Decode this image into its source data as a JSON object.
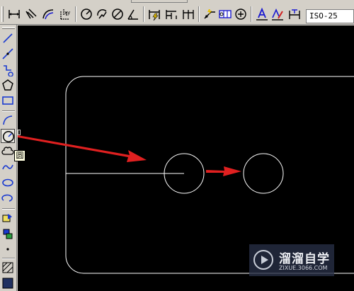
{
  "toolbar": {
    "dim_style_value": "ISO-25",
    "icons": [
      "linear-dim-icon",
      "aligned-dim-icon",
      "arc-length-icon",
      "ordinate-dim-icon",
      "radius-dim-icon",
      "jogged-dim-icon",
      "diameter-dim-icon",
      "angular-dim-icon",
      "quick-dim-icon",
      "baseline-dim-icon",
      "continue-dim-icon",
      "tolerance-icon",
      "quick-leader-icon",
      "center-mark-icon",
      "dim-edit-icon",
      "dim-text-edit-icon"
    ]
  },
  "draw_toolbar": {
    "icons": [
      "line-icon",
      "construction-line-icon",
      "polyline-icon",
      "polygon-icon",
      "rectangle-icon",
      "arc-icon",
      "circle-icon",
      "revision-cloud-icon",
      "spline-icon",
      "ellipse-icon",
      "ellipse-arc-icon",
      "insert-block-icon",
      "make-block-icon",
      "point-icon",
      "hatch-icon",
      "gradient-icon"
    ],
    "active_tool": "circle-icon",
    "tooltip": "圆"
  },
  "canvas": {
    "background": "#000000",
    "entity_color": "#ffffff",
    "arrow_color": "#e02020"
  },
  "watermark": {
    "title": "溜溜自学",
    "url": "ZIXUE.3066.COM"
  }
}
